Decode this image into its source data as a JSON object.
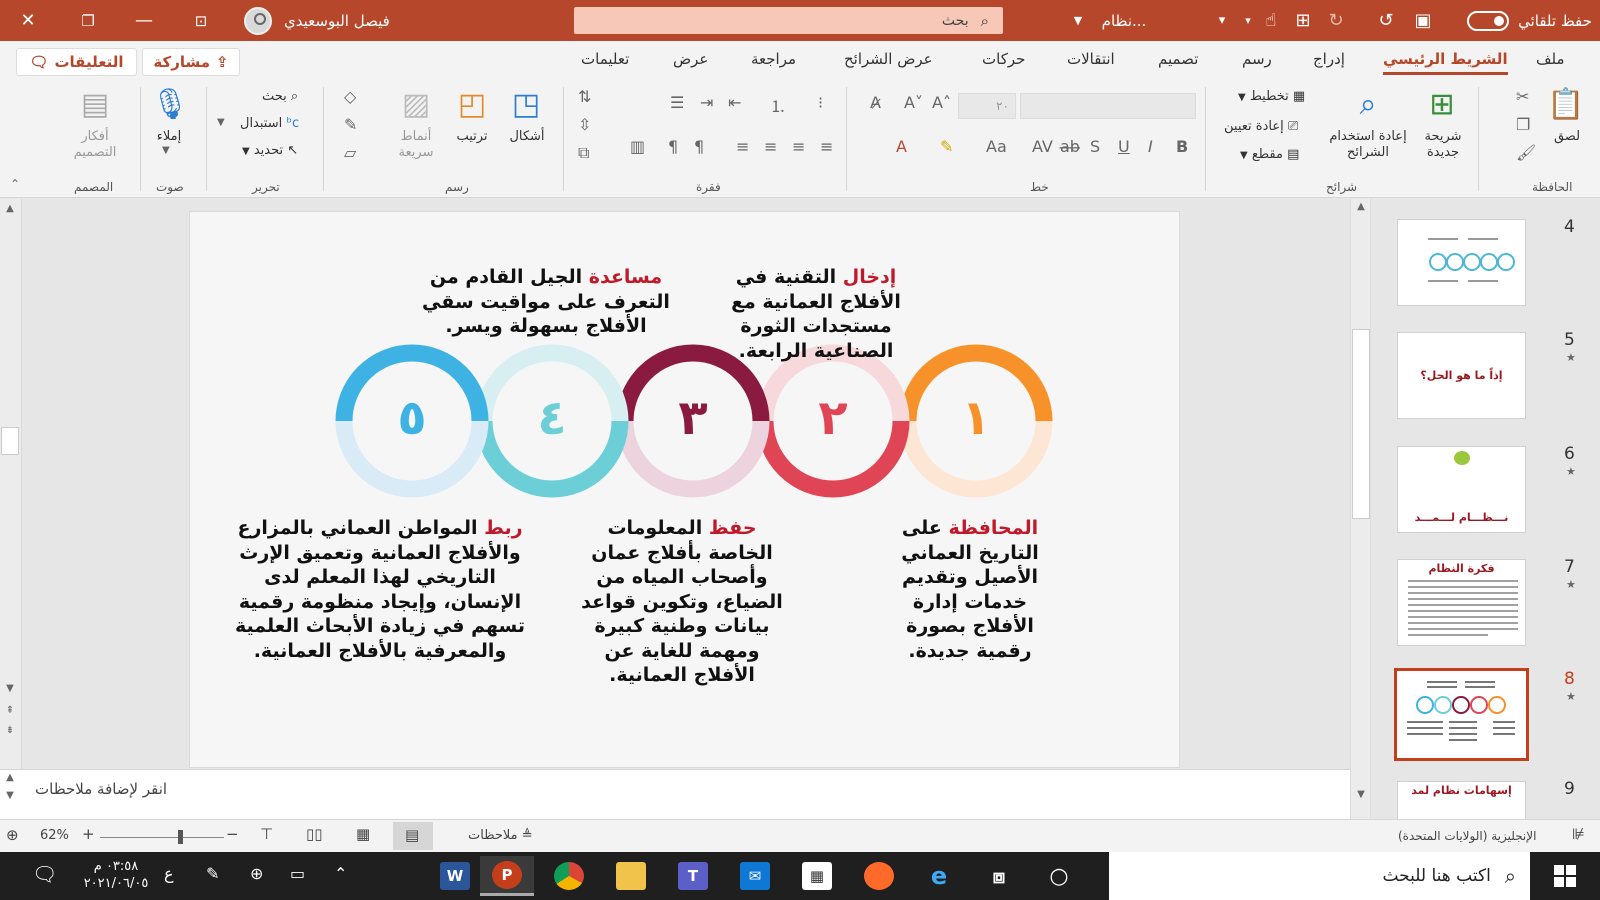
{
  "window": {
    "autosave_label": "حفظ تلقائي",
    "doc_name": "نظام...",
    "search_placeholder": "بحث",
    "user_name": "فيصل البوسعيدي"
  },
  "tabs": [
    {
      "label": "ملف"
    },
    {
      "label": "الشريط الرئيسي"
    },
    {
      "label": "إدراج"
    },
    {
      "label": "رسم"
    },
    {
      "label": "تصميم"
    },
    {
      "label": "انتقالات"
    },
    {
      "label": "حركات"
    },
    {
      "label": "عرض الشرائح"
    },
    {
      "label": "مراجعة"
    },
    {
      "label": "عرض"
    },
    {
      "label": "تعليمات"
    }
  ],
  "top_buttons": {
    "share": "مشاركة",
    "comments": "التعليقات"
  },
  "ribbon": {
    "clipboard": {
      "label": "الحافظة",
      "paste": "لصق"
    },
    "slides": {
      "label": "شرائح",
      "new_slide": "شريحة\nجديدة",
      "reuse": "إعادة استخدام\nالشرائح",
      "layout": "تخطيط",
      "reset": "إعادة تعيين",
      "section": "مقطع"
    },
    "font": {
      "label": "خط",
      "size": "٢٠"
    },
    "paragraph": {
      "label": "فقرة"
    },
    "drawing": {
      "label": "رسم",
      "shapes": "أشكال",
      "arrange": "ترتيب",
      "quick_styles": "أنماط\nسريعة"
    },
    "editing": {
      "label": "تحرير",
      "find": "بحث",
      "replace": "استبدال",
      "select": "تحديد"
    },
    "voice": {
      "label": "صوت",
      "dictate": "إملاء"
    },
    "designer": {
      "label": "المصمم",
      "ideas": "أفكار\nالتصميم"
    }
  },
  "slide": {
    "blocks": [
      {
        "keyword": "إدخال",
        "text": " التقنية في الأفلاج العمانية مع مستجدات الثورة الصناعية  الرابعة."
      },
      {
        "keyword": "مساعدة",
        "text": " الجيل القادم من التعرف على مواقيت سقي الأفلاج بسهولة ويسر."
      },
      {
        "keyword": "المحافظة",
        "text": " على التاريخ العماني الأصيل وتقديم خدمات إدارة الأفلاج بصورة رقمية جديدة."
      },
      {
        "keyword": "حفظ",
        "text": " المعلومات الخاصة بأفلاج عمان وأصحاب المياه من الضياع، وتكوين قواعد بيانات وطنية كبيرة ومهمة للغاية عن الأفلاج العمانية."
      },
      {
        "keyword": "ربط",
        "text": " المواطن العماني بالمزارع والأفلاج العمانية وتعميق الإرث التاريخي لهذا المعلم  لدى الإنسان، وإيجاد منظومة رقمية تسهم في زيادة الأبحاث العلمية والمعرفية بالأفلاج العمانية."
      }
    ],
    "numbers": [
      "١",
      "٢",
      "٣",
      "٤",
      "٥"
    ],
    "colors": {
      "n1": "#f7922a",
      "n2": "#e04555",
      "n3": "#8a1a3f",
      "n4": "#6ccfd8",
      "n5": "#3eb2e3"
    }
  },
  "thumbnails": [
    {
      "num": "4",
      "title": ""
    },
    {
      "num": "5",
      "title": "إذاً ما هو الحل؟"
    },
    {
      "num": "6",
      "title": "نـــظـــام لـــمـــد"
    },
    {
      "num": "7",
      "title": "فكرة النظام"
    },
    {
      "num": "8",
      "title": ""
    },
    {
      "num": "9",
      "title": "إسهامات نظام لمد"
    }
  ],
  "notes": {
    "placeholder": "انقر لإضافة ملاحظات"
  },
  "status": {
    "zoom": "62%",
    "notes_label": "ملاحظات",
    "language": "الإنجليزية (الولايات المتحدة)"
  },
  "taskbar": {
    "search_placeholder": "اكتب هنا للبحث",
    "time": "٠٣:٥٨ م",
    "date": "٢٠٢١/٠٦/٠٥",
    "lang": "ع"
  }
}
